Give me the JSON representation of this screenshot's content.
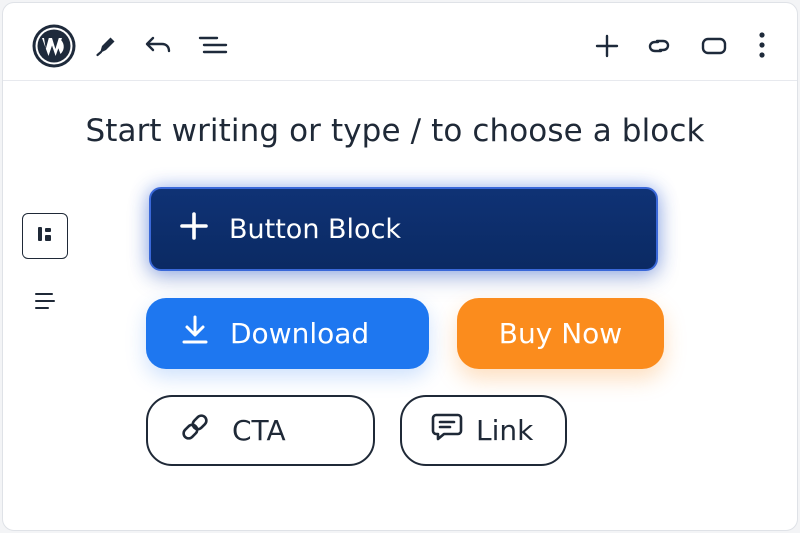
{
  "editor": {
    "placeholder": "Start writing or type / to choose a block"
  },
  "toolbar": {
    "left_icons": [
      "wordpress-logo-icon",
      "pencil-icon",
      "undo-icon",
      "list-view-icon"
    ],
    "right_icons": [
      "plus-icon",
      "link-icon",
      "rounded-rect-icon",
      "more-vertical-icon"
    ]
  },
  "sidebar": {
    "icons": [
      "block-switcher-icon",
      "align-icon"
    ]
  },
  "buttons": {
    "block": {
      "label": "Button Block",
      "icon": "plus-icon"
    },
    "download": {
      "label": "Download",
      "icon": "download-icon"
    },
    "buy_now": {
      "label": "Buy Now"
    },
    "cta": {
      "label": "CTA",
      "icon": "link-icon"
    },
    "link": {
      "label": "Link",
      "icon": "comment-icon"
    }
  },
  "colors": {
    "primary_dark": "#0f3275",
    "primary_blue": "#1e77f0",
    "accent_orange": "#fb8c1d",
    "text_dark": "#1f2937"
  }
}
